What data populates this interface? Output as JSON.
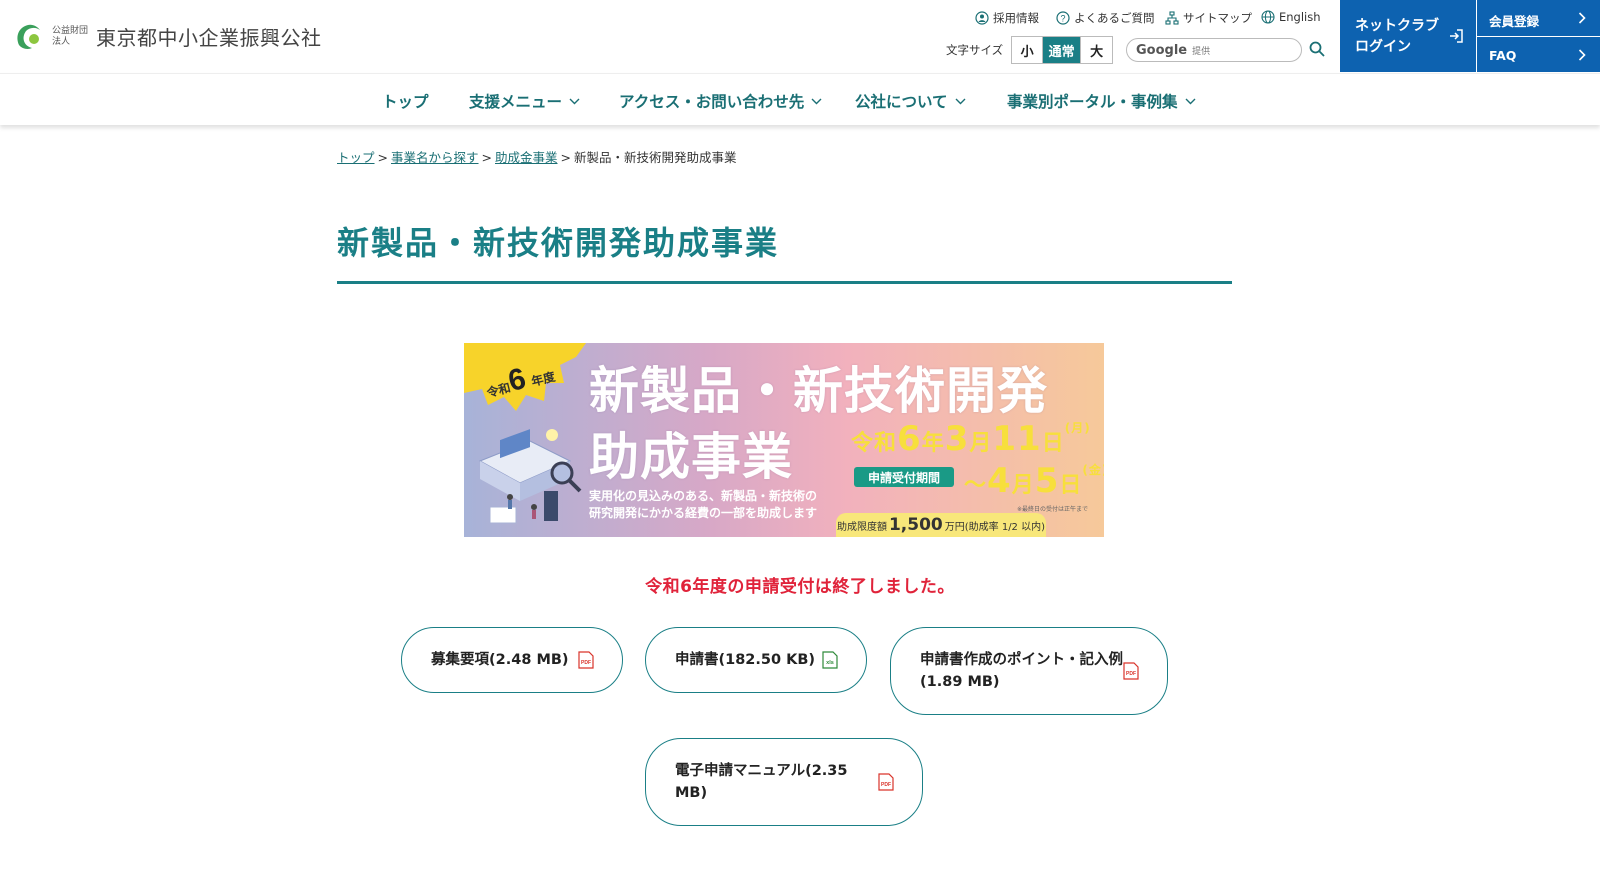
{
  "header": {
    "logo_small": "公益財団法人",
    "logo_name": "東京都中小企業振興公社",
    "util_links": [
      {
        "label": "採用情報",
        "icon": "user-circle-icon"
      },
      {
        "label": "よくあるご質問",
        "icon": "question-circle-icon"
      },
      {
        "label": "サイトマップ",
        "icon": "sitemap-icon"
      },
      {
        "label": "English",
        "icon": "globe-icon"
      }
    ],
    "font_size_label": "文字サイズ",
    "font_sizes": [
      "小",
      "通常",
      "大"
    ],
    "search_brand": "Google",
    "search_brand_suffix": "提供",
    "netclub_line1": "ネットクラブ",
    "netclub_line2": "ログイン",
    "member_label": "会員登録",
    "faq_label": "FAQ"
  },
  "nav": {
    "items": [
      "トップ",
      "支援メニュー",
      "アクセス・お問い合わせ先",
      "公社について",
      "事業別ポータル・事例集"
    ]
  },
  "breadcrumb": {
    "items": [
      "トップ",
      "事業名から探す",
      "助成金事業"
    ],
    "current": "新製品・新技術開発助成事業",
    "separator": ">"
  },
  "page": {
    "title": "新製品・新技術開発助成事業",
    "notice": "令和6年度の申請受付は終了しました。"
  },
  "banner": {
    "badge_prefix": "令和",
    "badge_num": "6",
    "badge_suffix": "年度",
    "title_line1": "新製品・新技術開発",
    "title_line2": "助成事業",
    "start_era": "令和",
    "start_year": "6",
    "start_year_unit": "年",
    "start_month": "3",
    "start_month_unit": "月",
    "start_day": "11",
    "start_day_unit": "日",
    "start_weekday": "(月)",
    "period_label": "申請受付期間",
    "end_tilde": "～",
    "end_month": "4",
    "end_month_unit": "月",
    "end_day": "5",
    "end_day_unit": "日",
    "end_weekday": "(金)",
    "subtitle_line1": "実用化の見込みのある、新製品・新技術の",
    "subtitle_line2": "研究開発にかかる経費の一部を助成します",
    "limit_prefix": "助成限度額",
    "limit_amount": "1,500",
    "limit_suffix": "万円(助成率 1/2 以内)",
    "note": "※最終日の受付は正午まで"
  },
  "downloads": [
    {
      "label": "募集要項(2.48 MB)",
      "type": "PDF",
      "icon": "pdf-file-icon"
    },
    {
      "label": "申請書(182.50 KB)",
      "type": "xls",
      "icon": "excel-file-icon"
    },
    {
      "label": "申請書作成のポイント・記入例(1.89 MB)",
      "type": "PDF",
      "icon": "pdf-file-icon"
    },
    {
      "label": "電子申請マニュアル(2.35 MB)",
      "type": "PDF",
      "icon": "pdf-file-icon"
    }
  ],
  "colors": {
    "brand_teal": "#1a7f86",
    "header_blue": "#0d62b0",
    "notice_red": "#e0233a",
    "banner_yellow": "#f7df3c"
  }
}
